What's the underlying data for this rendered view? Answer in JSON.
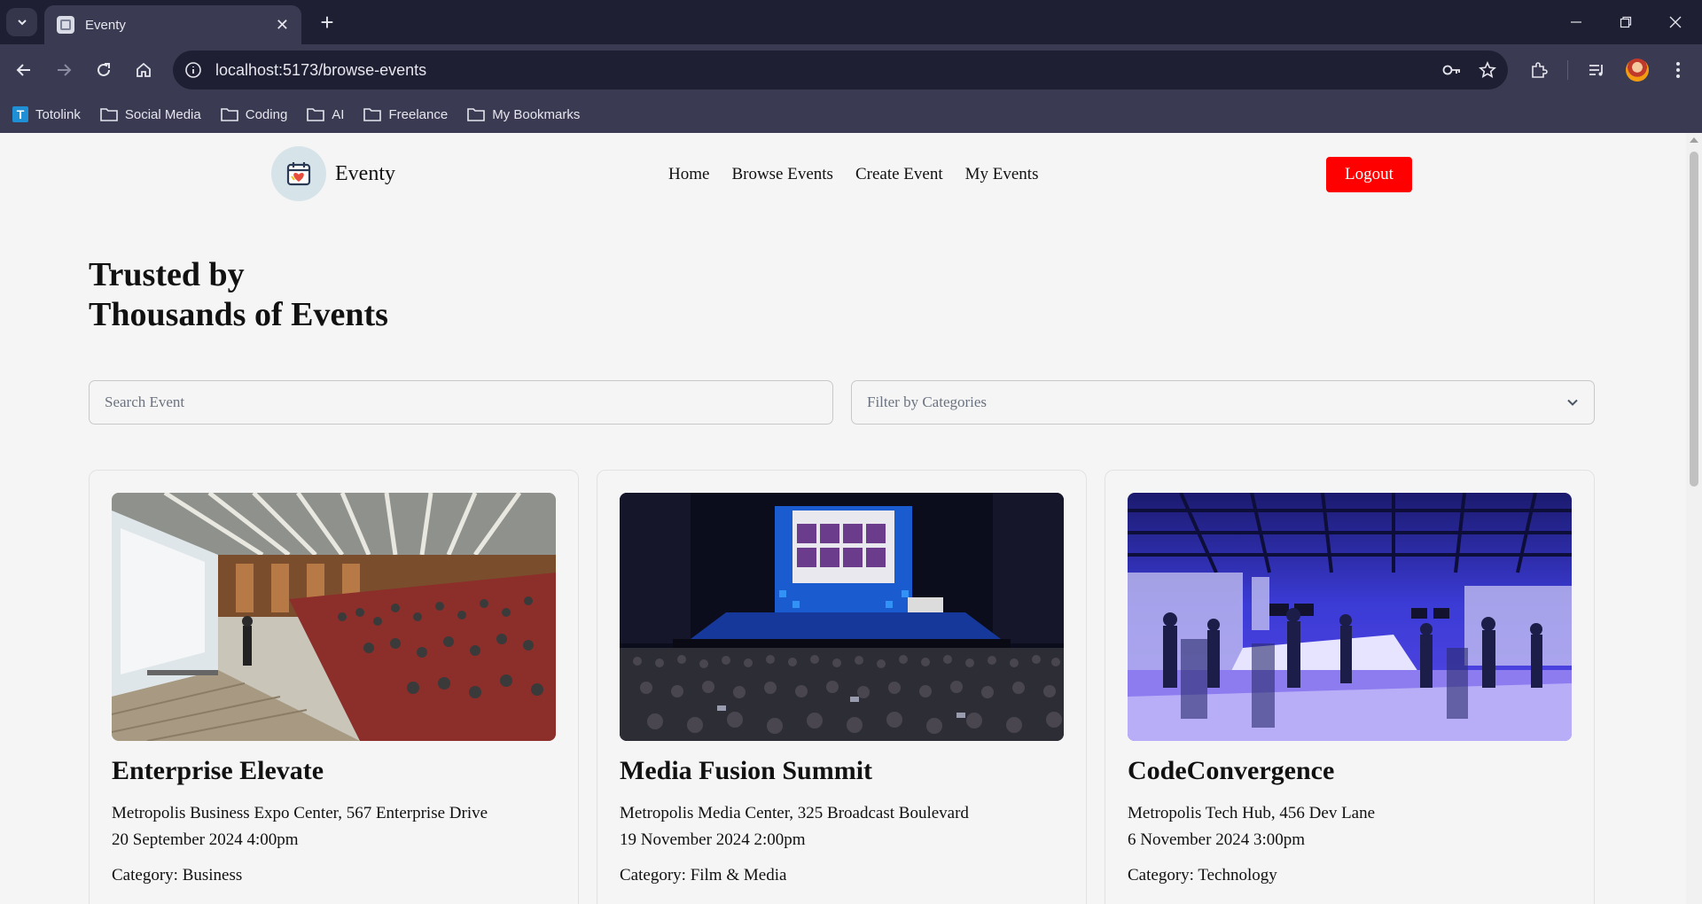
{
  "browser": {
    "tab_title": "Eventy",
    "url": "localhost:5173/browse-events",
    "bookmarks": [
      {
        "label": "Totolink",
        "icon": "totolink-icon"
      },
      {
        "label": "Social Media",
        "icon": "folder-icon"
      },
      {
        "label": "Coding",
        "icon": "folder-icon"
      },
      {
        "label": "AI",
        "icon": "folder-icon"
      },
      {
        "label": "Freelance",
        "icon": "folder-icon"
      },
      {
        "label": "My Bookmarks",
        "icon": "folder-icon"
      }
    ]
  },
  "site": {
    "brand": "Eventy",
    "nav": [
      "Home",
      "Browse Events",
      "Create Event",
      "My Events"
    ],
    "logout_label": "Logout",
    "accent_color": "#ff0000"
  },
  "hero": {
    "line1": "Trusted by",
    "line2": "Thousands of Events"
  },
  "search": {
    "placeholder": "Search Event",
    "value": ""
  },
  "filter": {
    "placeholder": "Filter by Categories"
  },
  "events": [
    {
      "title": "Enterprise Elevate",
      "location": "Metropolis Business Expo Center, 567 Enterprise Drive",
      "datetime": "20 September 2024 4:00pm",
      "category_label": "Category: ",
      "category": "Business"
    },
    {
      "title": "Media Fusion Summit",
      "location": "Metropolis Media Center, 325 Broadcast Boulevard",
      "datetime": "19 November 2024 2:00pm",
      "category_label": "Category: ",
      "category": "Film & Media"
    },
    {
      "title": "CodeConvergence",
      "location": "Metropolis Tech Hub, 456 Dev Lane",
      "datetime": "6 November 2024 3:00pm",
      "category_label": "Category: ",
      "category": "Technology"
    }
  ]
}
